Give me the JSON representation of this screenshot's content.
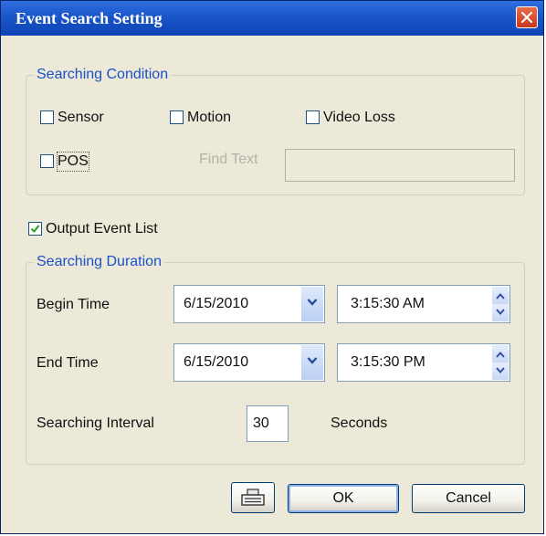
{
  "window": {
    "title": "Event Search Setting"
  },
  "searching_condition": {
    "legend": "Searching Condition",
    "sensor": {
      "label": "Sensor",
      "checked": false
    },
    "motion": {
      "label": "Motion",
      "checked": false
    },
    "video_loss": {
      "label": "Video Loss",
      "checked": false
    },
    "pos": {
      "label": "POS",
      "checked": false
    },
    "find_text": {
      "label": "Find Text",
      "value": ""
    }
  },
  "output_event_list": {
    "label": "Output Event List",
    "checked": true
  },
  "searching_duration": {
    "legend": "Searching Duration",
    "begin_time": {
      "label": "Begin Time",
      "date": "6/15/2010",
      "time": "3:15:30 AM"
    },
    "end_time": {
      "label": "End Time",
      "date": "6/15/2010",
      "time": "3:15:30 PM"
    },
    "interval": {
      "label": "Searching Interval",
      "value": "30",
      "unit": "Seconds"
    }
  },
  "buttons": {
    "ok": "OK",
    "cancel": "Cancel"
  },
  "icons": {
    "close": "close-icon",
    "keyboard": "keyboard-icon",
    "dropdown": "chevron-down-icon",
    "spin_up": "arrow-up-icon",
    "spin_down": "arrow-down-icon",
    "check": "checkmark-icon"
  },
  "colors": {
    "titlebar": "#1a55c9",
    "legend": "#1b50c8",
    "close": "#c7371a",
    "face": "#ece9d8"
  }
}
